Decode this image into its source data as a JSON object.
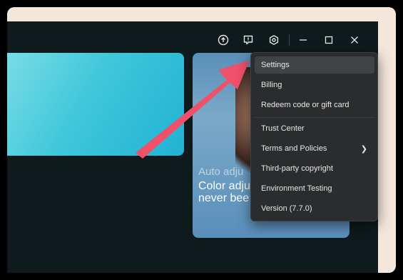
{
  "window": {
    "controls": [
      {
        "name": "upload-icon"
      },
      {
        "name": "feedback-icon"
      },
      {
        "name": "settings-gear-icon"
      },
      {
        "name": "minimize-icon"
      },
      {
        "name": "maximize-icon"
      },
      {
        "name": "close-icon"
      }
    ]
  },
  "cards": {
    "photo_caption_1": "Auto adju",
    "photo_caption_2": "Color adju never bee"
  },
  "menu": {
    "items": [
      {
        "label": "Settings",
        "active": true
      },
      {
        "label": "Billing"
      },
      {
        "label": "Redeem code or gift card"
      },
      {
        "label": "Trust Center"
      },
      {
        "label": "Terms and Policies",
        "has_submenu": true
      },
      {
        "label": "Third-party copyright"
      },
      {
        "label": "Environment Testing"
      },
      {
        "label": "Version (7.7.0)"
      }
    ]
  },
  "colors": {
    "app_bg": "#0f1a1c",
    "menu_bg": "#2a2c2e",
    "arrow": "#f0506a",
    "outer_bg": "#f5e6dc"
  }
}
